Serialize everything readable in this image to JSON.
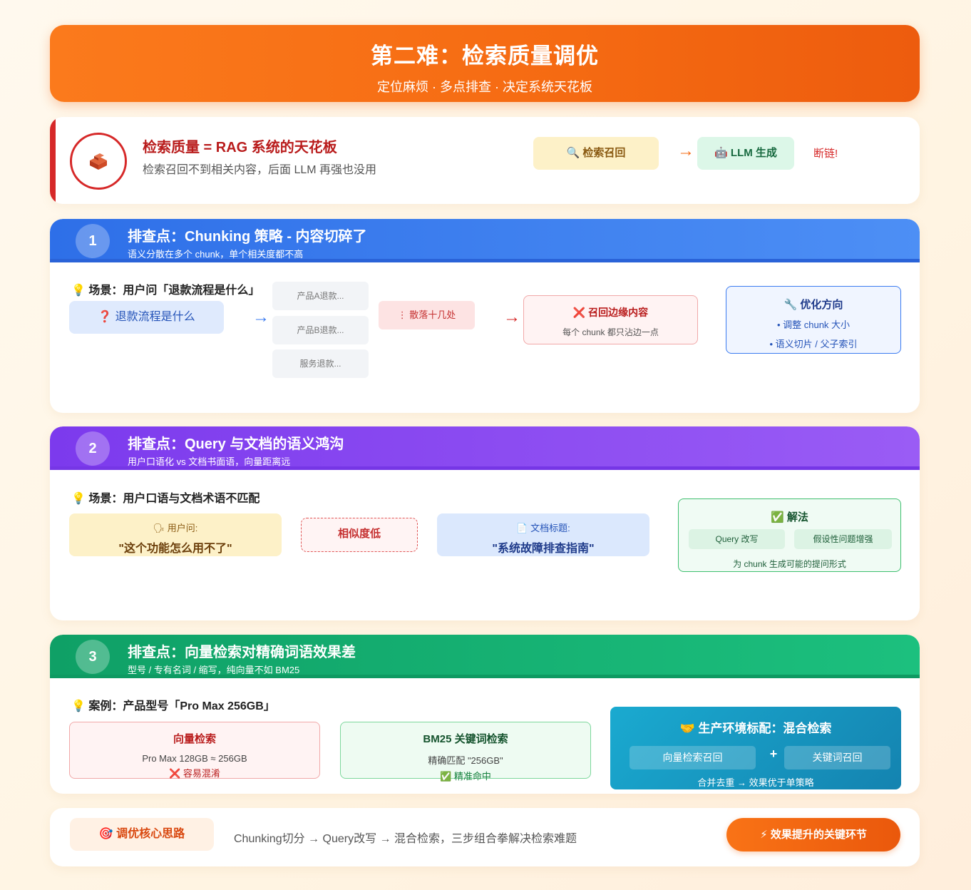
{
  "banner": {
    "title": "第二难：检索质量调优",
    "subtitle": "定位麻烦 · 多点排查 · 决定系统天花板"
  },
  "intro": {
    "heading": "检索质量 = RAG 系统的天花板",
    "desc": "检索召回不到相关内容，后面 LLM 再强也没用",
    "flow_retrieve": "🔍 检索召回",
    "arrow": "→",
    "flow_llm": "🤖 LLM 生成",
    "broken": "断链!"
  },
  "section1": {
    "number": "1",
    "title": "排查点：Chunking 策略 - 内容切碎了",
    "subtitle": "语义分散在多个 chunk，单个相关度都不高",
    "scene": "💡 场景：用户问「退款流程是什么」",
    "question": "❓ 退款流程是什么",
    "arrow1": "→",
    "chunks": [
      "产品A退款...",
      "产品B退款...",
      "服务退款..."
    ],
    "scattered": "⋮ 散落十几处",
    "arrow2": "→",
    "result_title": "❌ 召回边缘内容",
    "result_desc": "每个 chunk 都只沾边一点",
    "fix_title": "🔧 优化方向",
    "fix_items": [
      "• 调整 chunk 大小",
      "• 语义切片 / 父子索引"
    ]
  },
  "section2": {
    "number": "2",
    "title": "排查点：Query 与文档的语义鸿沟",
    "subtitle": "用户口语化 vs 文档书面语，向量距离远",
    "scene": "💡 场景：用户口语与文档术语不匹配",
    "user_label": "🗣 用户问:",
    "user_query": "\"这个功能怎么用不了\"",
    "similarity": "相似度低",
    "doc_label": "📄 文档标题:",
    "doc_title": "\"系统故障排查指南\"",
    "solution_title": "✅ 解法",
    "solution_tags": [
      "Query 改写",
      "假设性问题增强"
    ],
    "solution_desc": "为 chunk 生成可能的提问形式"
  },
  "section3": {
    "number": "3",
    "title": "排查点：向量检索对精确词语效果差",
    "subtitle": "型号 / 专有名词 / 缩写，纯向量不如 BM25",
    "scene": "💡 案例：产品型号「Pro Max 256GB」",
    "vector_title": "向量检索",
    "vector_line": "Pro Max 128GB ≈ 256GB",
    "vector_result": "❌ 容易混淆",
    "bm25_title": "BM25 关键词检索",
    "bm25_line": "精确匹配 \"256GB\"",
    "bm25_result": "✅ 精准命中",
    "hybrid_title": "🤝 生产环境标配：混合检索",
    "hybrid_left": "向量检索召回",
    "hybrid_plus": "+",
    "hybrid_right": "关键词召回",
    "hybrid_desc": "合并去重 → 效果优于单策略"
  },
  "bottom": {
    "label": "🎯 调优核心思路",
    "text": "Chunking切分 → Query改写 → 混合检索，三步组合拳解决检索难题",
    "button": "⚡ 效果提升的关键环节"
  },
  "colors": {
    "orange": "#f56a12",
    "red": "#d62828",
    "blue": "#3b7bf0",
    "purple": "#8a4df0",
    "green": "#12b272",
    "teal": "#1a9fc6"
  }
}
